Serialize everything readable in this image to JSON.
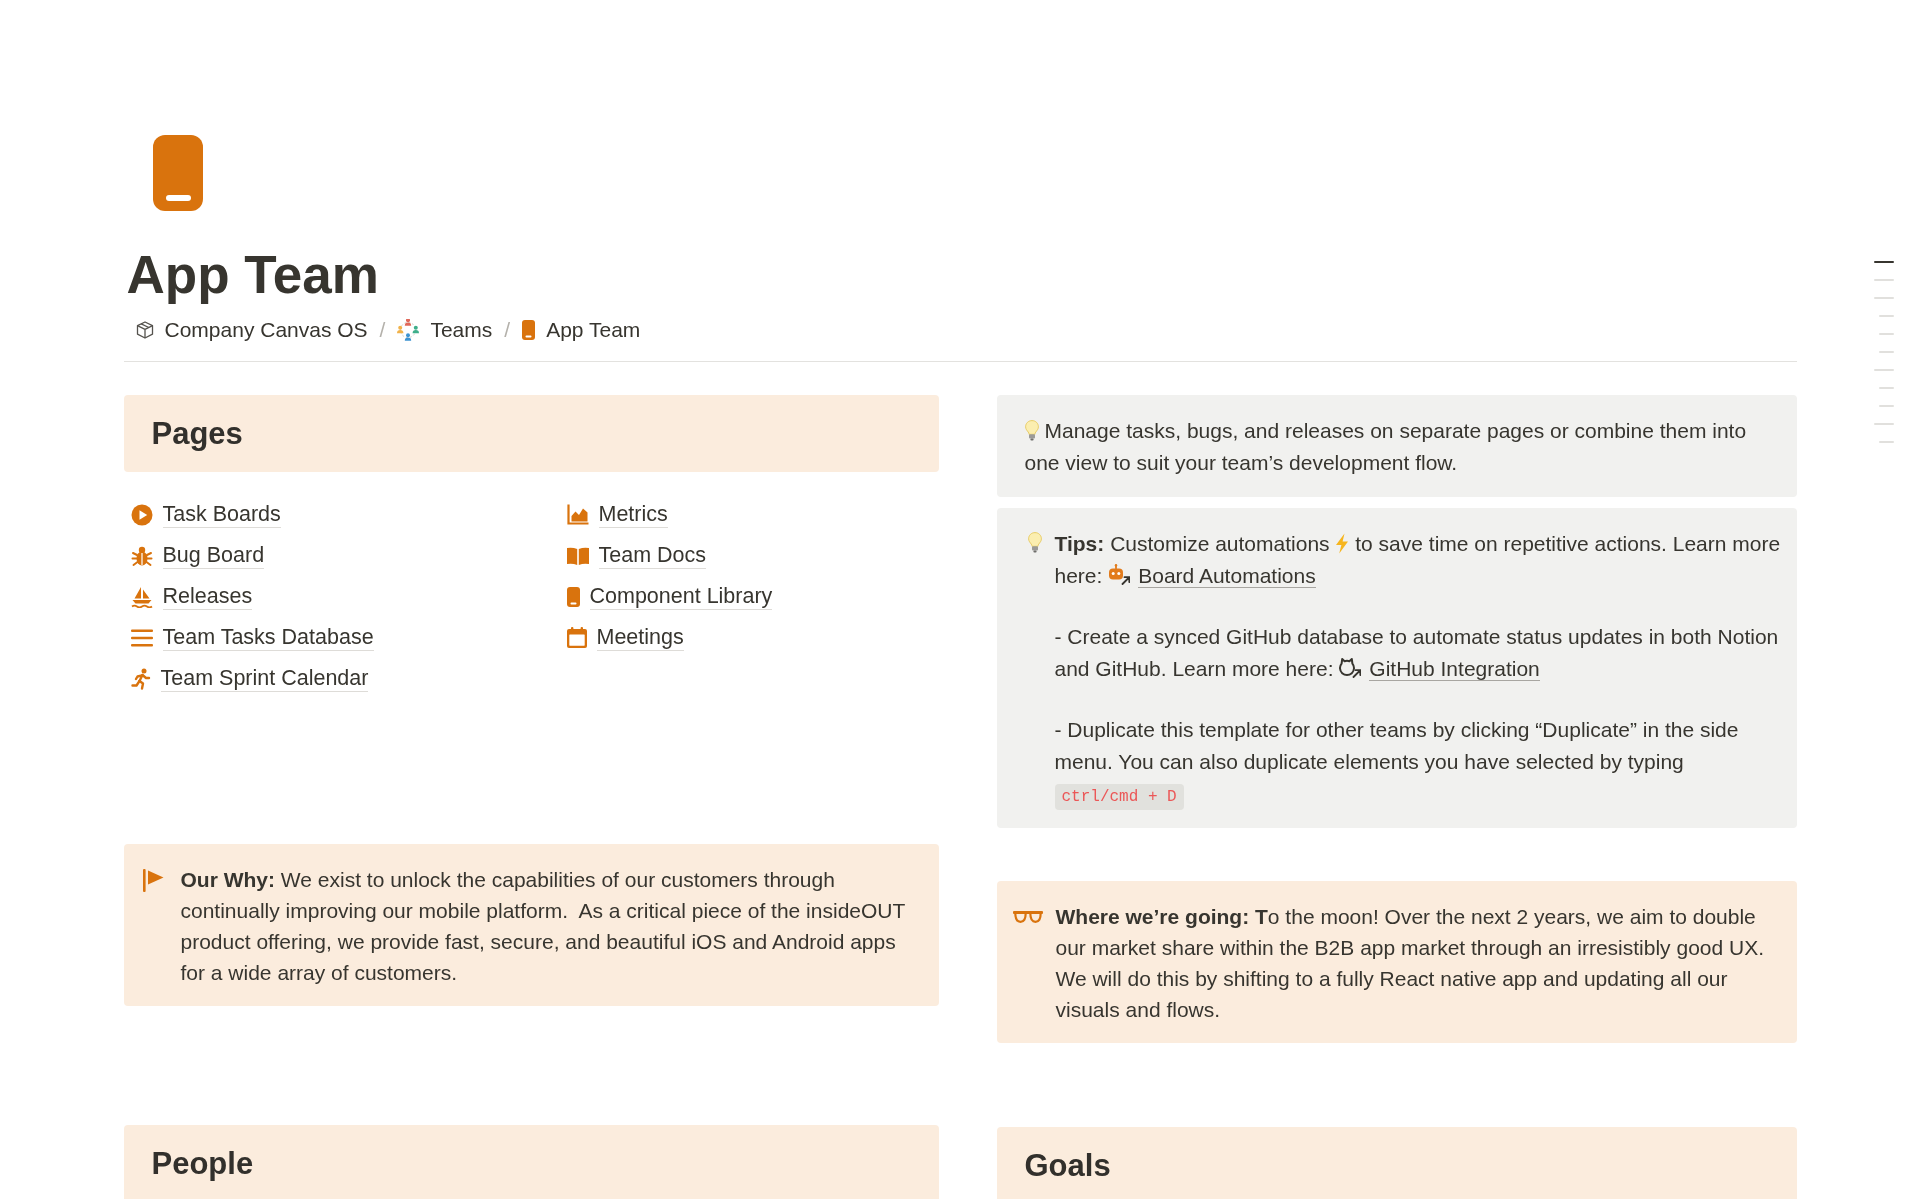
{
  "page": {
    "title": "App Team"
  },
  "breadcrumb": [
    {
      "label": "Company Canvas OS",
      "separator": "/"
    },
    {
      "label": "Teams",
      "separator": "/"
    },
    {
      "label": "App Team"
    }
  ],
  "left_column": {
    "pages": {
      "heading": "Pages",
      "columns": [
        [
          "Task Boards",
          "Bug Board",
          "Releases",
          "Team Tasks Database",
          "Team Sprint Calendar"
        ],
        [
          "Metrics",
          "Team Docs",
          "Component Library",
          "Meetings"
        ]
      ]
    },
    "why_callout": {
      "text": "**Our Why:** We exist to unlock the capabilities of our customers through continually improving our mobile platform.  As a critical piece of the insideOUT product offering, we provide fast, secure, and beautiful iOS and Android apps for a wide array of customers."
    },
    "people": {
      "heading": "People"
    }
  },
  "right_column": {
    "info_callout": {
      "text": "Manage tasks, bugs, and releases on separate pages or combine them into one view to suit your team’s development flow."
    },
    "tips_callout": {
      "paragraphs": [
        {
          "text": "**Tips:** Customize automations",
          "text_after_icon": "to save time on repetitive actions. Learn more here:",
          "link": "Board Automations"
        },
        {
          "text": "- Create a synced GitHub database to automate status updates in both Notion and GitHub. Learn more here:",
          "link": "GitHub Integration"
        },
        {
          "text": "- Duplicate this template for other teams by clicking “Duplicate” in the side menu. You can also duplicate elements you have selected by typing",
          "code": "ctrl/cmd + D"
        }
      ]
    },
    "vision_callout": {
      "text": "**Where we’re going: T**o the moon! Over the next 2 years, we aim to double our market share within the B2B app market through an irresistibly good UX. We will do this by shifting to a fully React native app and updating all our visuals and flows."
    },
    "goals": {
      "heading": "Goals"
    }
  },
  "outline": [
    {
      "selected": true
    },
    {
      "selected": false
    },
    {
      "selected": false,
      "children": [
        {
          "selected": false
        },
        {
          "selected": false
        },
        {
          "selected": false
        }
      ]
    },
    {
      "selected": false,
      "children": [
        {
          "selected": false
        },
        {
          "selected": false
        }
      ]
    },
    {
      "selected": false,
      "children": [
        {
          "selected": false
        }
      ]
    }
  ]
}
